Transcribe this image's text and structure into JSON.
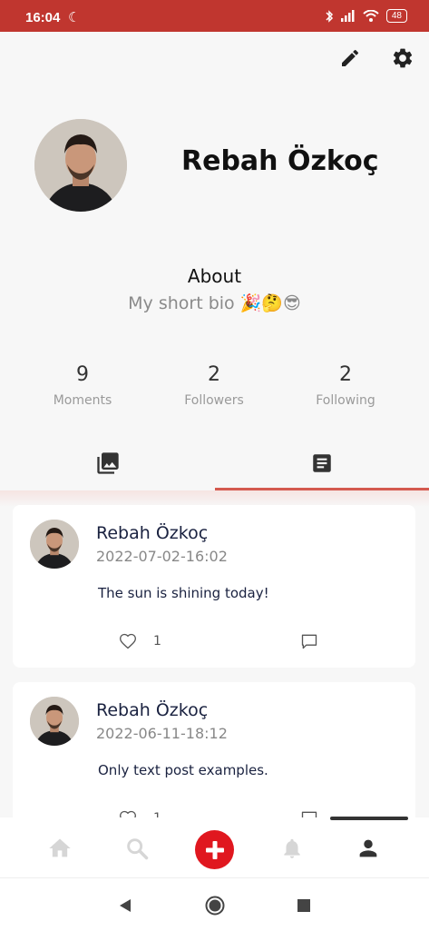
{
  "status_bar": {
    "time": "16:04",
    "battery": "48"
  },
  "profile": {
    "name": "Rebah Özkoç",
    "about_title": "About",
    "bio": "My short bio 🎉🤔😎"
  },
  "stats": [
    {
      "value": "9",
      "label": "Moments"
    },
    {
      "value": "2",
      "label": "Followers"
    },
    {
      "value": "2",
      "label": "Following"
    }
  ],
  "tabs": {
    "active": "text-posts"
  },
  "posts": [
    {
      "author": "Rebah Özkoç",
      "date": "2022-07-02-16:02",
      "text": "The sun is shining today!",
      "likes": "1"
    },
    {
      "author": "Rebah Özkoç",
      "date": "2022-06-11-18:12",
      "text": "Only text post examples.",
      "likes": "1"
    }
  ],
  "colors": {
    "accent": "#c0362f",
    "fab": "#e0171f",
    "tab_indicator": "#d45a4f"
  },
  "icons": {
    "toolbar": [
      "pencil-icon",
      "gear-icon"
    ],
    "tabs": [
      "photo-library-icon",
      "article-icon"
    ],
    "bottom_nav": [
      "home-icon",
      "search-icon",
      "add-icon",
      "bell-icon",
      "person-icon"
    ],
    "system_nav": [
      "back-icon",
      "home-circle-icon",
      "recents-icon"
    ]
  }
}
